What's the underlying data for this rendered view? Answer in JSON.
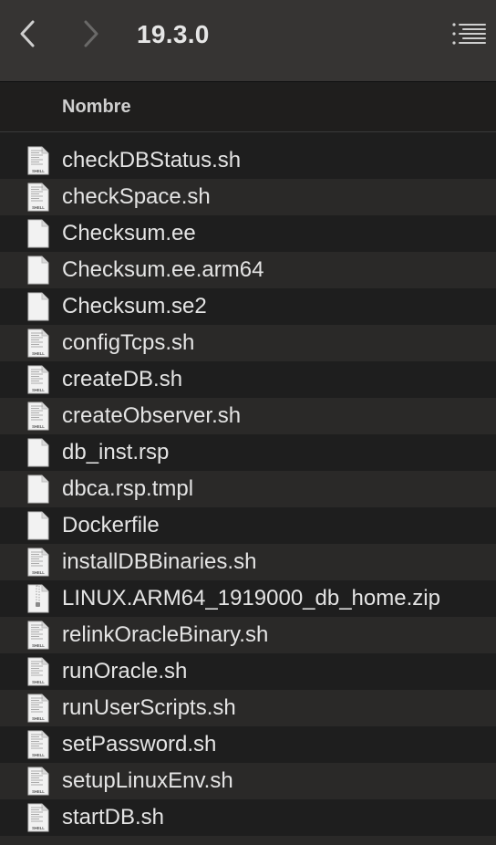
{
  "toolbar": {
    "title": "19.3.0",
    "back_icon": "chevron-left-icon",
    "forward_icon": "chevron-right-icon",
    "view_icon": "list-view-icon"
  },
  "header": {
    "name_column": "Nombre"
  },
  "files": [
    {
      "name": "checkDBStatus.sh",
      "icon": "shell-file-icon"
    },
    {
      "name": "checkSpace.sh",
      "icon": "shell-file-icon"
    },
    {
      "name": "Checksum.ee",
      "icon": "blank-file-icon"
    },
    {
      "name": "Checksum.ee.arm64",
      "icon": "blank-file-icon"
    },
    {
      "name": "Checksum.se2",
      "icon": "blank-file-icon"
    },
    {
      "name": "configTcps.sh",
      "icon": "shell-file-icon"
    },
    {
      "name": "createDB.sh",
      "icon": "shell-file-icon"
    },
    {
      "name": "createObserver.sh",
      "icon": "shell-file-icon"
    },
    {
      "name": "db_inst.rsp",
      "icon": "blank-file-icon"
    },
    {
      "name": "dbca.rsp.tmpl",
      "icon": "blank-file-icon"
    },
    {
      "name": "Dockerfile",
      "icon": "blank-file-icon"
    },
    {
      "name": "installDBBinaries.sh",
      "icon": "shell-file-icon"
    },
    {
      "name": "LINUX.ARM64_1919000_db_home.zip",
      "icon": "zip-file-icon"
    },
    {
      "name": "relinkOracleBinary.sh",
      "icon": "shell-file-icon"
    },
    {
      "name": "runOracle.sh",
      "icon": "shell-file-icon"
    },
    {
      "name": "runUserScripts.sh",
      "icon": "shell-file-icon"
    },
    {
      "name": "setPassword.sh",
      "icon": "shell-file-icon"
    },
    {
      "name": "setupLinuxEnv.sh",
      "icon": "shell-file-icon"
    },
    {
      "name": "startDB.sh",
      "icon": "shell-file-icon"
    }
  ],
  "shell_icon_label": "SHELL",
  "colors": {
    "toolbar_bg": "#363433",
    "window_bg": "#1e1e1e",
    "alt_row_bg": "#2a2928",
    "text": "#e4e4e4"
  }
}
